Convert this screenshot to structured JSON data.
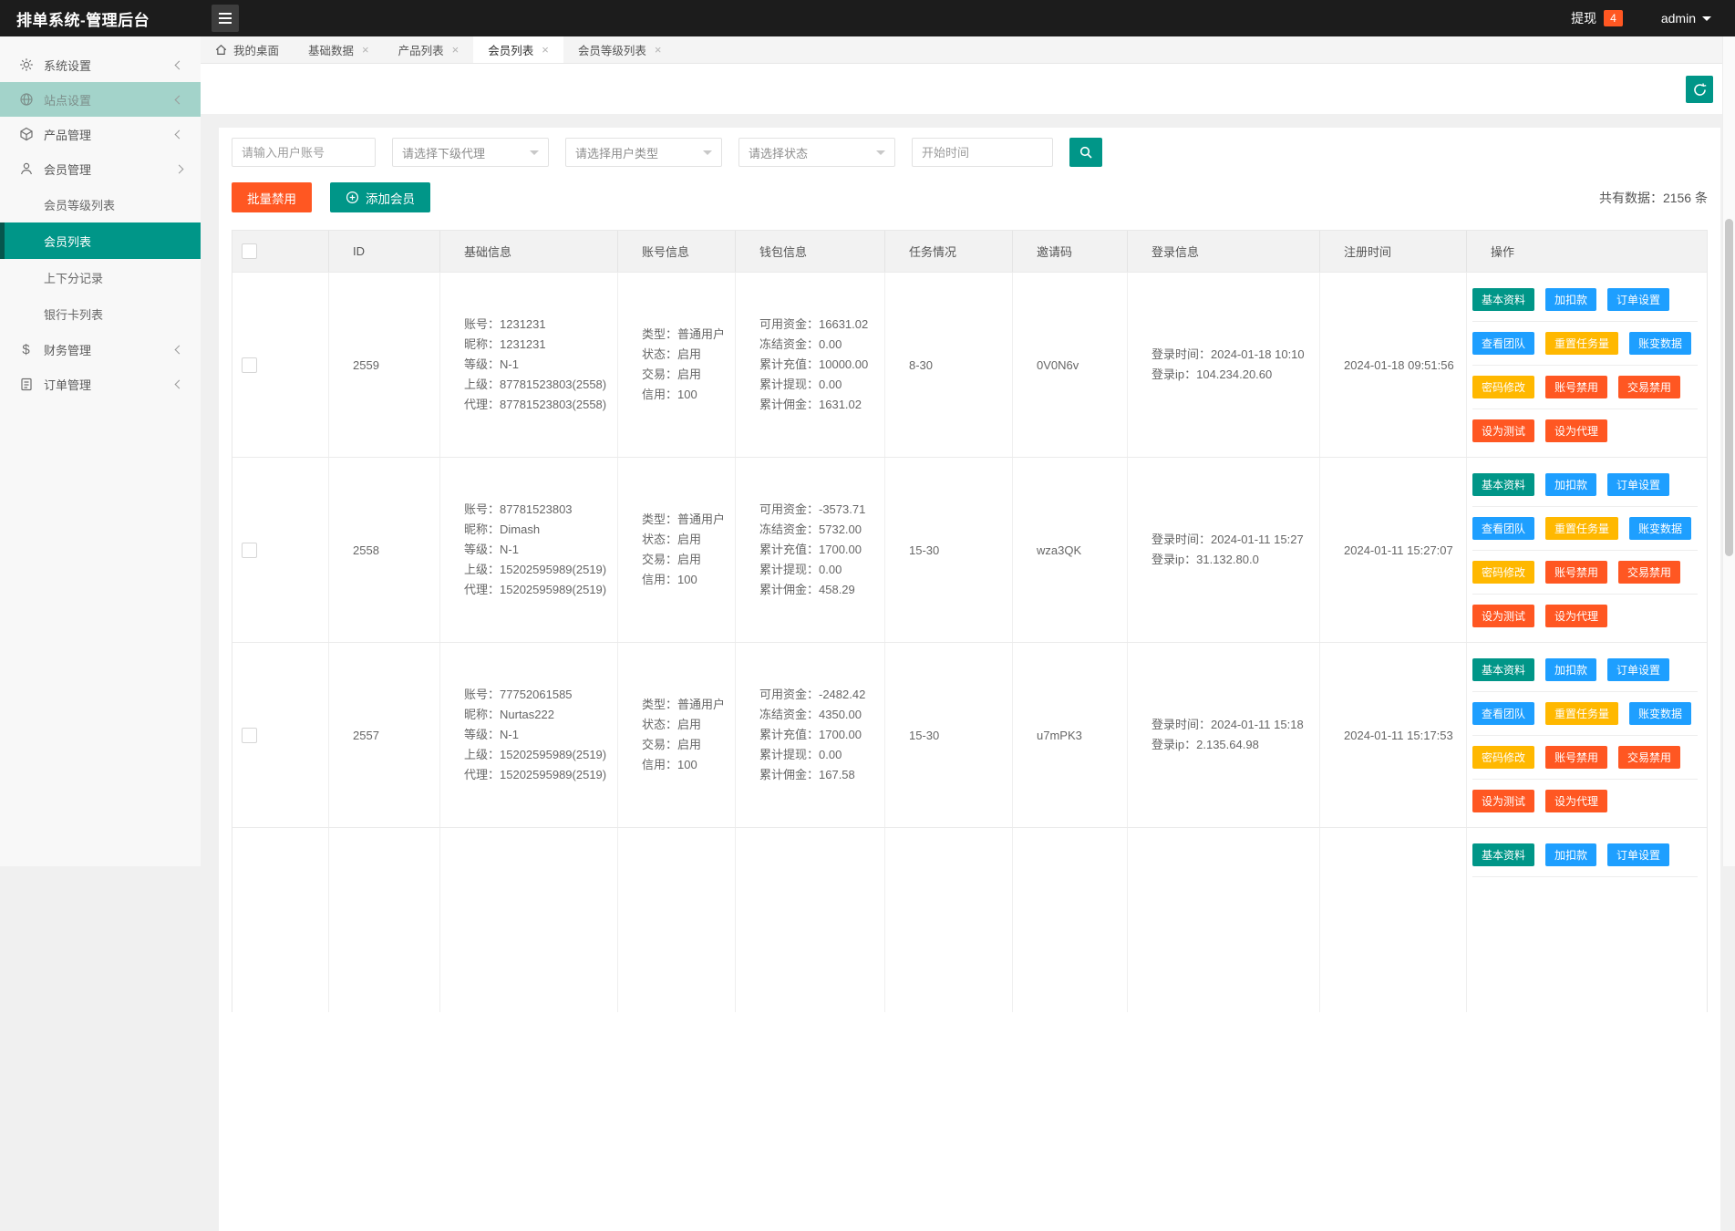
{
  "header": {
    "title": "排单系统-管理后台",
    "withdraw_label": "提现",
    "withdraw_count": "4",
    "username": "admin"
  },
  "sidebar": {
    "items": [
      {
        "label": "系统设置",
        "icon": "gear"
      },
      {
        "label": "站点设置",
        "icon": "globe"
      },
      {
        "label": "产品管理",
        "icon": "cube"
      },
      {
        "label": "会员管理",
        "icon": "user"
      },
      {
        "label": "财务管理",
        "icon": "dollar"
      },
      {
        "label": "订单管理",
        "icon": "clipboard"
      }
    ],
    "submenu": [
      {
        "label": "会员等级列表"
      },
      {
        "label": "会员列表",
        "active": true
      },
      {
        "label": "上下分记录"
      },
      {
        "label": "银行卡列表"
      }
    ]
  },
  "tabs": [
    {
      "label": "我的桌面",
      "closable": false
    },
    {
      "label": "基础数据",
      "closable": true
    },
    {
      "label": "产品列表",
      "closable": true
    },
    {
      "label": "会员列表",
      "closable": true,
      "active": true
    },
    {
      "label": "会员等级列表",
      "closable": true
    }
  ],
  "filters": {
    "account_placeholder": "请输入用户账号",
    "agent_placeholder": "请选择下级代理",
    "type_placeholder": "请选择用户类型",
    "status_placeholder": "请选择状态",
    "time_placeholder": "开始时间"
  },
  "toolbar": {
    "batch_disable": "批量禁用",
    "add_member": "添加会员",
    "total": "共有数据：2156 条"
  },
  "table": {
    "columns": [
      "",
      "ID",
      "基础信息",
      "账号信息",
      "钱包信息",
      "任务情况",
      "邀请码",
      "登录信息",
      "注册时间",
      "操作"
    ],
    "labels": {
      "basic": [
        "账号",
        "昵称",
        "等级",
        "上级",
        "代理"
      ],
      "account": [
        "类型",
        "状态",
        "交易",
        "信用"
      ],
      "wallet": [
        "可用资金",
        "冻结资金",
        "累计充值",
        "累计提现",
        "累计佣金"
      ],
      "login": [
        "登录时间",
        "登录ip"
      ]
    },
    "rows": [
      {
        "id": "2559",
        "basic": [
          "1231231",
          "1231231",
          "N-1",
          "87781523803(2558)",
          "87781523803(2558)"
        ],
        "account": [
          "普通用户",
          "启用",
          "启用",
          "100"
        ],
        "wallet": [
          "16631.02",
          "0.00",
          "10000.00",
          "0.00",
          "1631.02"
        ],
        "task": "8-30",
        "invite": "0V0N6v",
        "login": [
          "2024-01-18 10:10",
          "104.234.20.60"
        ],
        "registered": "2024-01-18 09:51:56",
        "partial": false
      },
      {
        "id": "2558",
        "basic": [
          "87781523803",
          "Dimash",
          "N-1",
          "15202595989(2519)",
          "15202595989(2519)"
        ],
        "account": [
          "普通用户",
          "启用",
          "启用",
          "100"
        ],
        "wallet": [
          "-3573.71",
          "5732.00",
          "1700.00",
          "0.00",
          "458.29"
        ],
        "task": "15-30",
        "invite": "wza3QK",
        "login": [
          "2024-01-11 15:27",
          "31.132.80.0"
        ],
        "registered": "2024-01-11 15:27:07",
        "partial": false
      },
      {
        "id": "2557",
        "basic": [
          "77752061585",
          "Nurtas222",
          "N-1",
          "15202595989(2519)",
          "15202595989(2519)"
        ],
        "account": [
          "普通用户",
          "启用",
          "启用",
          "100"
        ],
        "wallet": [
          "-2482.42",
          "4350.00",
          "1700.00",
          "0.00",
          "167.58"
        ],
        "task": "15-30",
        "invite": "u7mPK3",
        "login": [
          "2024-01-11 15:18",
          "2.135.64.98"
        ],
        "registered": "2024-01-11 15:17:53",
        "partial": false
      },
      {
        "id": "",
        "basic": [],
        "account": [],
        "wallet": [],
        "task": "",
        "invite": "",
        "login": [],
        "registered": "",
        "partial": true
      }
    ]
  },
  "actions": {
    "groups": [
      [
        {
          "label": "基本资料",
          "color": "teal"
        },
        {
          "label": "加扣款",
          "color": "blue"
        },
        {
          "label": "订单设置",
          "color": "blue"
        }
      ],
      [
        {
          "label": "查看团队",
          "color": "blue"
        },
        {
          "label": "重置任务量",
          "color": "yellow"
        },
        {
          "label": "账变数据",
          "color": "blue"
        }
      ],
      [
        {
          "label": "密码修改",
          "color": "yellow"
        },
        {
          "label": "账号禁用",
          "color": "red"
        },
        {
          "label": "交易禁用",
          "color": "red"
        }
      ],
      [
        {
          "label": "设为测试",
          "color": "red"
        },
        {
          "label": "设为代理",
          "color": "red"
        }
      ]
    ]
  },
  "colors": {
    "teal": "#009688",
    "blue": "#1E9FFF",
    "yellow": "#FFB800",
    "red": "#FF5722",
    "header_bg": "#1c1c1c"
  }
}
